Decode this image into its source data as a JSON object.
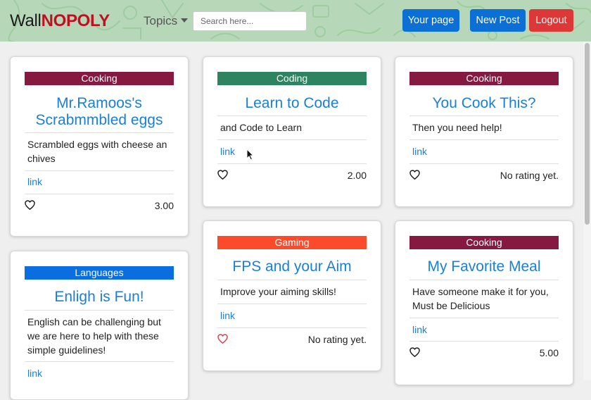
{
  "brand": {
    "part1": "Wall",
    "part2": "NOPOLY"
  },
  "nav": {
    "topics_label": "Topics",
    "search_placeholder": "Search here...",
    "your_page": "Your page",
    "new_post": "New Post",
    "logout": "Logout"
  },
  "colors": {
    "cooking": "#86193f",
    "coding": "#2e8462",
    "gaming": "#fc4b2b",
    "languages": "#0a6de0",
    "link": "#1b7fd6",
    "primary_button": "#0b6fd6",
    "danger_button": "#dc3837"
  },
  "cards": [
    {
      "category": "Cooking",
      "title": "Mr.Ramoos's Scrabmmbled eggs",
      "description": "Scrambled eggs with cheese an chives",
      "link": "link",
      "rating": "3.00",
      "liked": false
    },
    {
      "category": "Coding",
      "title": "Learn to Code",
      "description": "and Code to Learn",
      "link": "link",
      "rating": "2.00",
      "liked": false
    },
    {
      "category": "Cooking",
      "title": "You Cook This?",
      "description": "Then you need help!",
      "link": "link",
      "rating": "No rating yet.",
      "liked": false
    },
    {
      "category": "Languages",
      "title": "Enligh is Fun!",
      "description": "English can be challenging but we are here to help with these simple guidelines!",
      "link": "link",
      "rating": "",
      "liked": false
    },
    {
      "category": "Gaming",
      "title": "FPS and your Aim",
      "description": "Improve your aiming skills!",
      "link": "link",
      "rating": "No rating yet.",
      "liked": true
    },
    {
      "category": "Cooking",
      "title": "My Favorite Meal",
      "description": "Have someone make it for you, Must be Delicious",
      "link": "link",
      "rating": "5.00",
      "liked": false
    }
  ]
}
